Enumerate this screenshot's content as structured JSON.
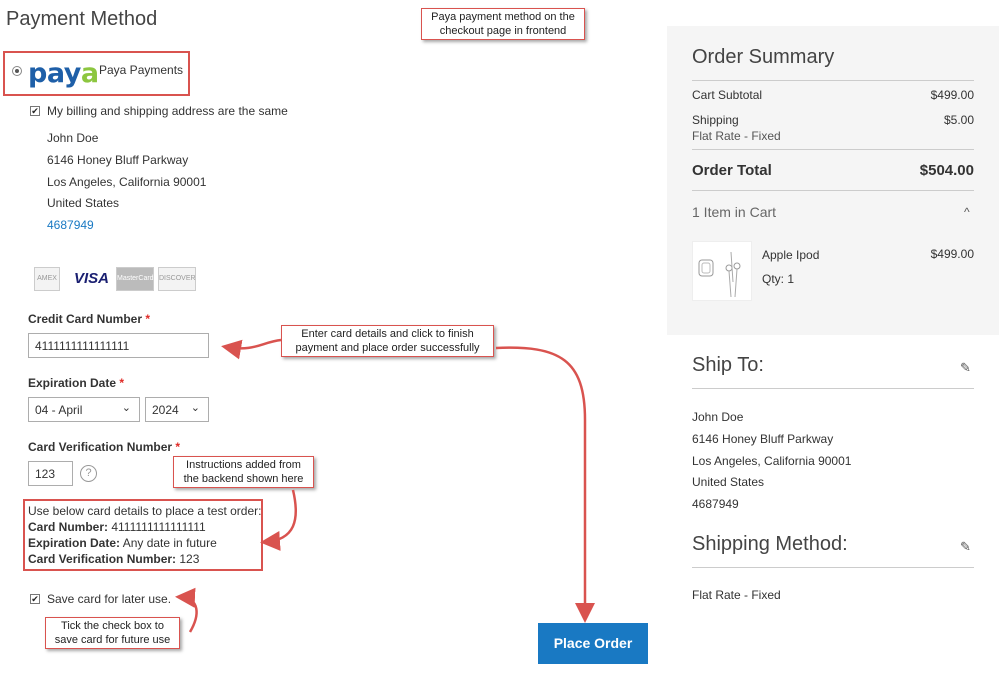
{
  "page_title": "Payment Method",
  "callouts": {
    "top": [
      "Paya payment method on the",
      "checkout page in frontend"
    ],
    "card": [
      "Enter card details and click to finish",
      "payment and place order successfully"
    ],
    "instructions": [
      "Instructions added from",
      "the backend shown here"
    ],
    "save": [
      "Tick the check box to",
      "save card for future use"
    ]
  },
  "payment": {
    "logo_text": "pay",
    "logo_swoosh": "a",
    "method_label": "Paya Payments",
    "billing_same_label": "My billing and shipping address are the same"
  },
  "billing_address": {
    "name": "John Doe",
    "street": "6146 Honey Bluff Parkway",
    "city_line": "Los Angeles, California 90001",
    "country": "United States",
    "phone": "4687949"
  },
  "card_brands": {
    "amex": "AMEX",
    "visa": "VISA",
    "mastercard": "MasterCard",
    "discover": "DISCOVER"
  },
  "form": {
    "cc_number_label": "Credit Card Number",
    "cc_number_value": "4111111111111111",
    "required_mark": "*",
    "expiration_label": "Expiration Date",
    "month_value": "04 - April",
    "year_value": "2024",
    "cvv_label": "Card Verification Number",
    "cvv_value": "123",
    "help": "?"
  },
  "instructions": {
    "intro": "Use below card details to place a test order:",
    "card_number_key": "Card Number:",
    "card_number_val": " 4111111111111111",
    "expiration_key": "Expiration Date:",
    "expiration_val": " Any date in future",
    "cvv_key": "Card Verification Number:",
    "cvv_val": " 123"
  },
  "save_card_label": "Save card for later use.",
  "place_order_label": "Place Order",
  "order_summary": {
    "title": "Order Summary",
    "cart_subtotal_label": "Cart Subtotal",
    "cart_subtotal_value": "$499.00",
    "shipping_label": "Shipping",
    "shipping_sub": "Flat Rate - Fixed",
    "shipping_value": "$5.00",
    "order_total_label": "Order Total",
    "order_total_value": "$504.00",
    "items_in_cart": "1 Item in Cart",
    "item_name": "Apple Ipod",
    "item_qty": "Qty: 1",
    "item_price": "$499.00"
  },
  "ship_to": {
    "title": "Ship To:",
    "name": "John Doe",
    "street": "6146 Honey Bluff Parkway",
    "city_line": "Los Angeles, California 90001",
    "country": "United States",
    "phone": "4687949"
  },
  "shipping_method": {
    "title": "Shipping Method:",
    "value": "Flat Rate - Fixed"
  },
  "icons": {
    "pencil": "✎",
    "chevron_up": "^",
    "chevron_down": "⌄",
    "check": "✔"
  },
  "colors": {
    "accent": "#1979c3",
    "annotation": "#d9534f",
    "required": "#e02b27"
  }
}
